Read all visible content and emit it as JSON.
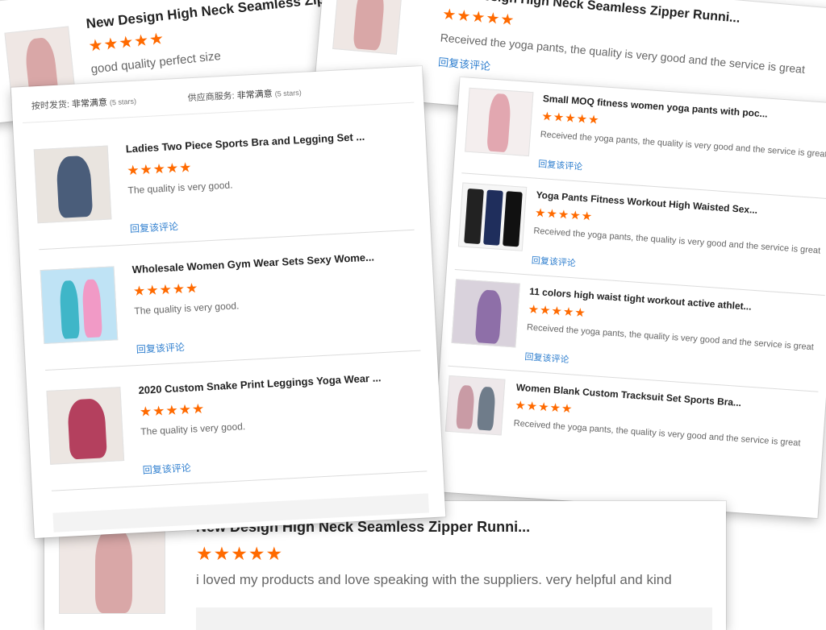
{
  "back_top_left": {
    "title": "New Design High Neck Seamless Zippe",
    "comment": "good quality perfect size"
  },
  "back_top_right": {
    "title": "New Design High Neck Seamless Zipper Runni...",
    "comment": "Received the yoga pants, the quality is very good and the service is great",
    "reply": "回复该评论"
  },
  "left_card": {
    "delivery_label": "按时发货:",
    "delivery_value": "非常满意",
    "delivery_stars": "(5 stars)",
    "service_label": "供应商服务:",
    "service_value": "非常满意",
    "service_stars": "(5 stars)",
    "reviews": [
      {
        "title": "Ladies Two Piece Sports Bra and Legging Set ...",
        "comment": "The quality is very good.",
        "reply": "回复该评论"
      },
      {
        "title": "Wholesale Women Gym Wear Sets Sexy Wome...",
        "comment": "The quality is very good.",
        "reply": "回复该评论"
      },
      {
        "title": "2020 Custom Snake Print Leggings Yoga Wear ...",
        "comment": "The quality is very good.",
        "reply": "回复该评论"
      }
    ]
  },
  "right_card": {
    "reviews": [
      {
        "title": "Small MOQ fitness women yoga pants with poc...",
        "comment": "Received the yoga pants, the quality is very good and the service is great",
        "reply": "回复该评论"
      },
      {
        "title": "Yoga Pants Fitness Workout High Waisted Sex...",
        "comment": "Received the yoga pants, the quality is very good and the service is great",
        "reply": "回复该评论"
      },
      {
        "title": "11 colors high waist tight workout active athlet...",
        "comment": "Received the yoga pants, the quality is very good and the service is great",
        "reply": "回复该评论"
      },
      {
        "title": "Women Blank Custom Tracksuit Set Sports Bra...",
        "comment": "Received the yoga pants, the quality is very good and the service is great"
      }
    ]
  },
  "bottom_card": {
    "title": "New Design High Neck Seamless Zipper Runni...",
    "comment": "i loved my products and love speaking with the suppliers. very helpful and kind"
  },
  "rating": 5,
  "star_glyph": "★",
  "colors": {
    "star": "#ff6a00",
    "link": "#2f7fcf"
  }
}
